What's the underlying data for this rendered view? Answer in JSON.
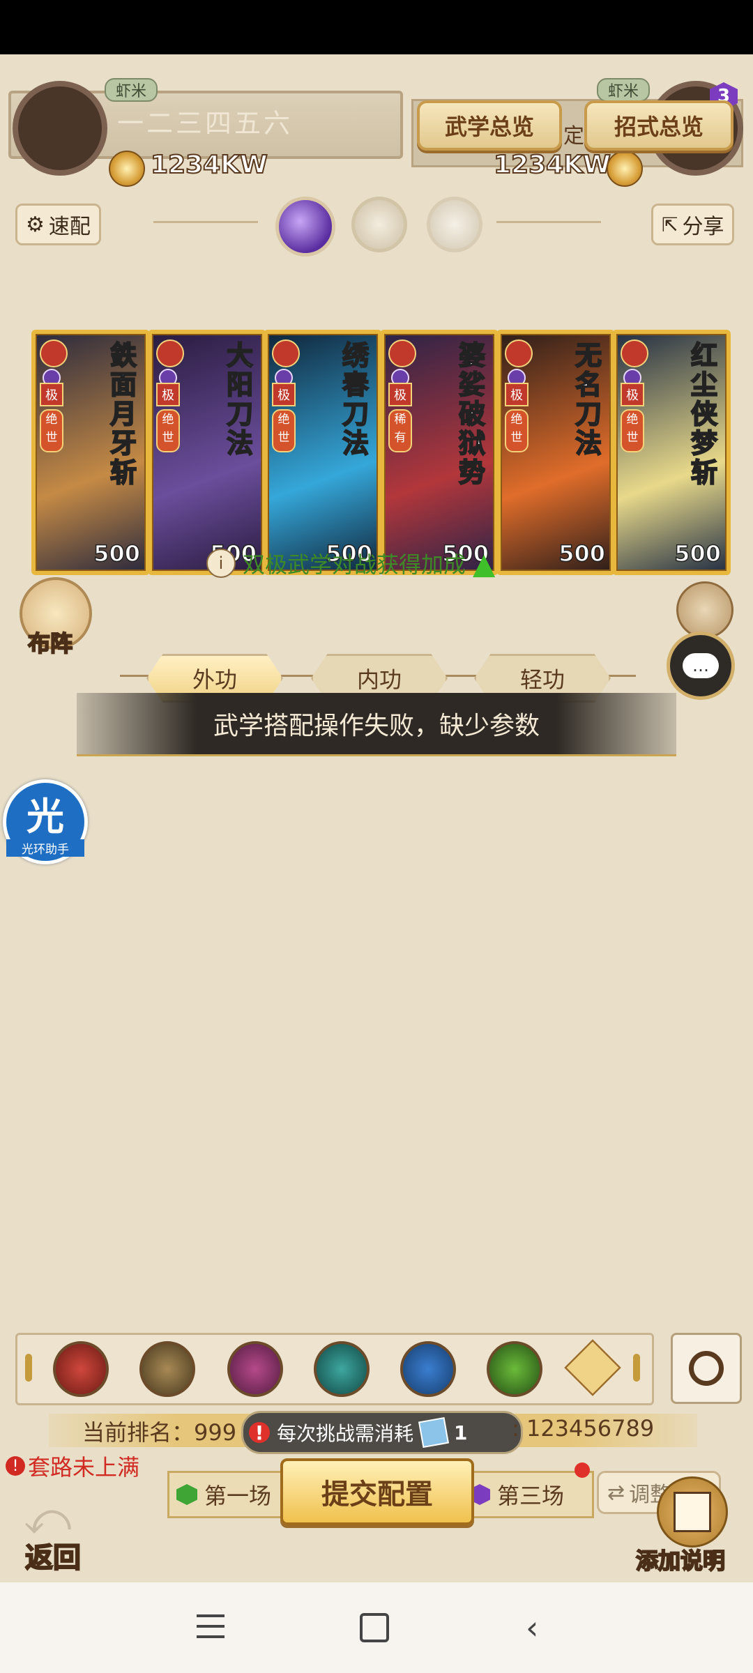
{
  "top": {
    "player_left_name": "一二三四五六",
    "player_left_tag": "虾米",
    "player_left_power": "1234KW",
    "player_right_tag": "虾米",
    "player_right_power": "1234KW",
    "player_right_badge": "3",
    "btn_overview_wuxue": "武学总览",
    "btn_overview_zhaoshi": "招式总览",
    "partial_text": "定"
  },
  "actions": {
    "quick_config": "速配",
    "share": "分享"
  },
  "cards": [
    {
      "title": "鉄面月牙斩",
      "grade": "极",
      "rarity": "绝世",
      "value": "500",
      "colors": [
        "#2b2a3d",
        "#c58a45"
      ]
    },
    {
      "title": "大阳刀法",
      "grade": "极",
      "rarity": "绝世",
      "value": "500",
      "colors": [
        "#2a1c3f",
        "#6b4e9c"
      ]
    },
    {
      "title": "绣春刀法",
      "grade": "极",
      "rarity": "绝世",
      "value": "500",
      "colors": [
        "#10263b",
        "#35a7d9"
      ]
    },
    {
      "title": "婆娑破狱势",
      "grade": "极",
      "rarity": "稀有",
      "value": "500",
      "colors": [
        "#2c2347",
        "#b2373b"
      ]
    },
    {
      "title": "无名刀法",
      "grade": "极",
      "rarity": "绝世",
      "value": "500",
      "colors": [
        "#2d1e1a",
        "#e06d2a"
      ]
    },
    {
      "title": "红尘侠梦斩",
      "grade": "极",
      "rarity": "绝世",
      "value": "500",
      "colors": [
        "#243044",
        "#e8d98a"
      ]
    }
  ],
  "bonus_text": "双极武学对战获得加成",
  "formation_label": "布阵",
  "tabs": [
    "外功",
    "内功",
    "轻功"
  ],
  "toast": "武学搭配操作失败，缺少参数",
  "helper_label": "光环助手",
  "helper_glyph": "光",
  "ranking": {
    "label_rank": "当前排名：",
    "rank_value": "999",
    "cost_label": "每次挑战需消耗",
    "cost_value": "1",
    "tail_value": ": 123456789"
  },
  "warning": "套路未上满",
  "matches": [
    "第一场",
    "第三场"
  ],
  "submit": "提交配置",
  "adjust": "调整",
  "back": "返回",
  "add_note": "添加说明",
  "icons": [
    "sword-icon",
    "dagger-icon",
    "fist-icon",
    "fan-icon",
    "yinyang-icon",
    "whip-icon",
    "chevron-up-icon"
  ],
  "colors": {
    "bg": "#e9dfc9",
    "gold": "#e7b83d",
    "green": "#3fa535"
  }
}
